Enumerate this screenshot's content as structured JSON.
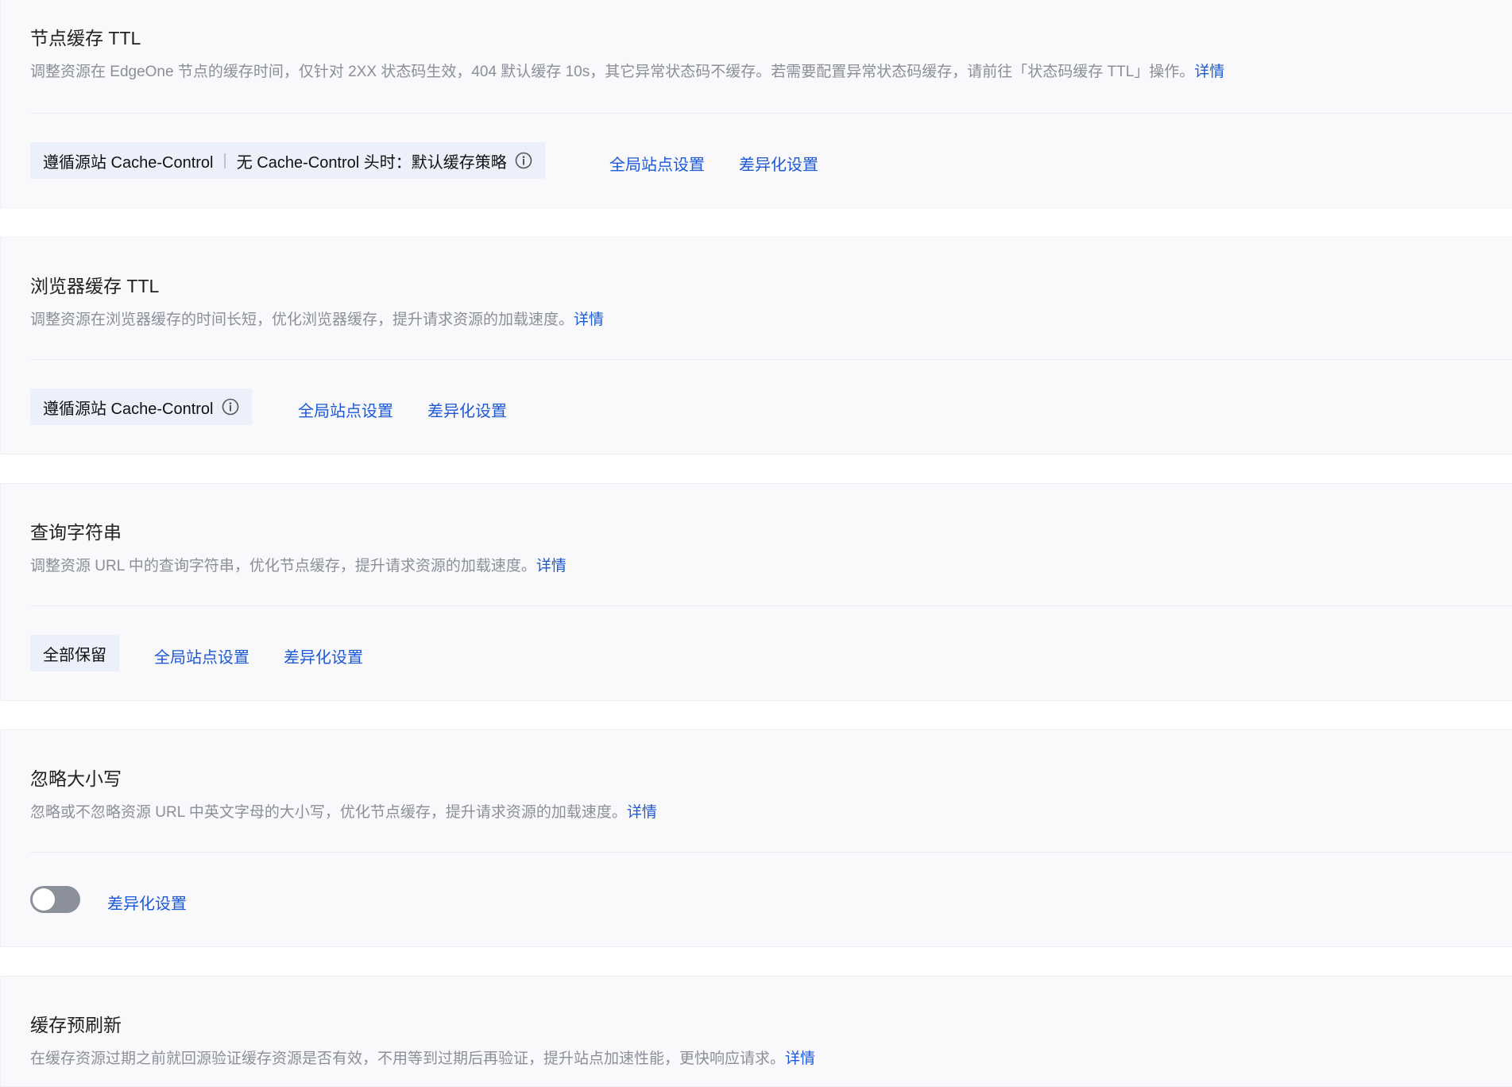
{
  "sections": {
    "node_ttl": {
      "title": "节点缓存 TTL",
      "desc": "调整资源在 EdgeOne 节点的缓存时间，仅针对 2XX 状态码生效，404 默认缓存 10s，其它异常状态码不缓存。若需要配置异常状态码缓存，请前往「状态码缓存 TTL」操作。",
      "detail": "详情",
      "tag_main": "遵循源站 Cache-Control",
      "tag_sep": "|",
      "tag_extra": "无 Cache-Control 头时：默认缓存策略",
      "global_link": "全局站点设置",
      "diff_link": "差异化设置"
    },
    "browser_ttl": {
      "title": "浏览器缓存 TTL",
      "desc": "调整资源在浏览器缓存的时间长短，优化浏览器缓存，提升请求资源的加载速度。",
      "detail": "详情",
      "tag_main": "遵循源站 Cache-Control",
      "global_link": "全局站点设置",
      "diff_link": "差异化设置"
    },
    "query_string": {
      "title": "查询字符串",
      "desc": "调整资源 URL 中的查询字符串，优化节点缓存，提升请求资源的加载速度。",
      "detail": "详情",
      "tag_main": "全部保留",
      "global_link": "全局站点设置",
      "diff_link": "差异化设置"
    },
    "ignore_case": {
      "title": "忽略大小写",
      "desc": "忽略或不忽略资源 URL 中英文字母的大小写，优化节点缓存，提升请求资源的加载速度。",
      "detail": "详情",
      "toggle_on": false,
      "diff_link": "差异化设置"
    },
    "prefresh": {
      "title": "缓存预刷新",
      "desc": "在缓存资源过期之前就回源验证缓存资源是否有效，不用等到过期后再验证，提升站点加速性能，更快响应请求。",
      "detail": "详情"
    }
  },
  "colors": {
    "link": "#1d59d6",
    "card_bg": "#f9f9fb",
    "tag_bg": "#ebf0fa",
    "toggle_off": "#8b909a"
  },
  "icons": {
    "info": "info-circle-icon"
  }
}
